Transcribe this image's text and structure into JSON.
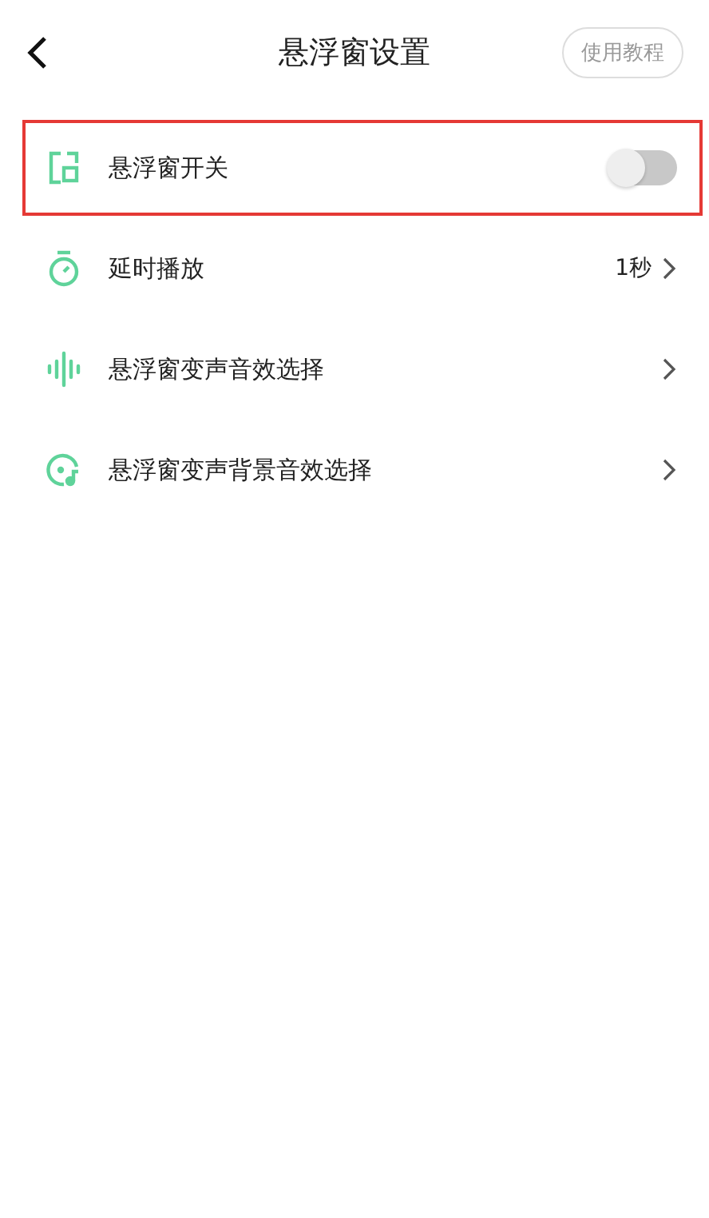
{
  "header": {
    "title": "悬浮窗设置",
    "help_button": "使用教程"
  },
  "settings": [
    {
      "kind": "toggle",
      "label": "悬浮窗开关",
      "on": false,
      "highlighted": true
    },
    {
      "kind": "link",
      "label": "延时播放",
      "value": "1秒",
      "highlighted": false
    },
    {
      "kind": "link",
      "label": "悬浮窗变声音效选择",
      "highlighted": false
    },
    {
      "kind": "link",
      "label": "悬浮窗变声背景音效选择",
      "highlighted": false
    }
  ]
}
